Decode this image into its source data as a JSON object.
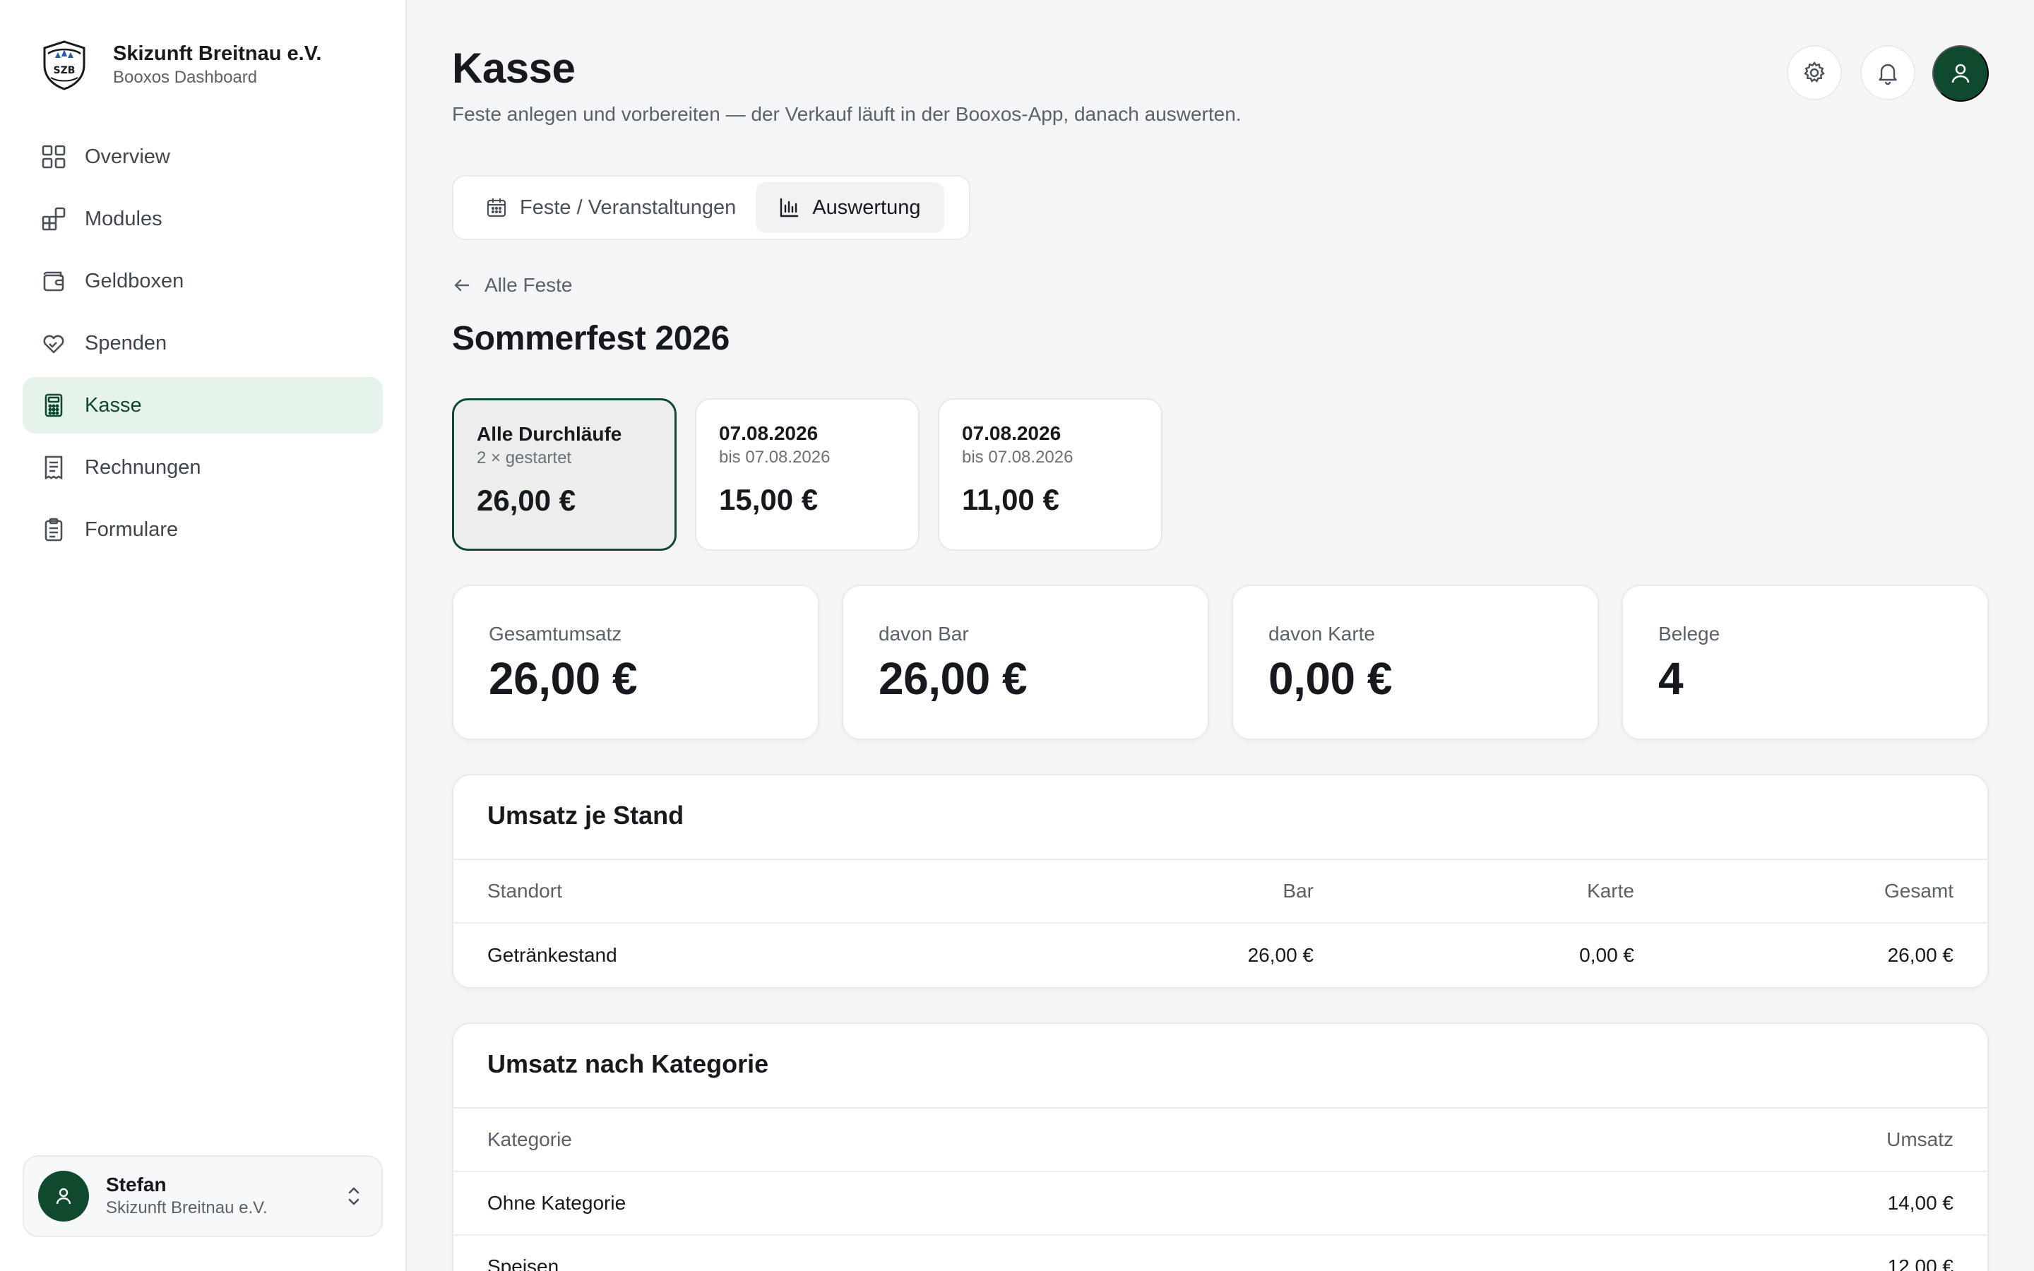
{
  "brand": {
    "name": "Skizunft Breitnau e.V.",
    "subtitle": "Booxos Dashboard",
    "logo_text": "SZB"
  },
  "nav": [
    {
      "label": "Overview",
      "icon": "grid-icon",
      "active": false
    },
    {
      "label": "Modules",
      "icon": "modules-icon",
      "active": false
    },
    {
      "label": "Geldboxen",
      "icon": "wallet-icon",
      "active": false
    },
    {
      "label": "Spenden",
      "icon": "heart-hand-icon",
      "active": false
    },
    {
      "label": "Kasse",
      "icon": "calculator-icon",
      "active": true
    },
    {
      "label": "Rechnungen",
      "icon": "receipt-icon",
      "active": false
    },
    {
      "label": "Formulare",
      "icon": "clipboard-icon",
      "active": false
    }
  ],
  "user": {
    "name": "Stefan",
    "org": "Skizunft Breitnau e.V."
  },
  "header": {
    "title": "Kasse",
    "subtitle": "Feste anlegen und vorbereiten — der Verkauf läuft in der Booxos-App, danach auswerten."
  },
  "tabs": [
    {
      "label": "Feste / Veranstaltungen",
      "icon": "calendar-icon",
      "active": false
    },
    {
      "label": "Auswertung",
      "icon": "bar-chart-icon",
      "active": true
    }
  ],
  "back_link": "Alle Feste",
  "event_title": "Sommerfest 2026",
  "runs": [
    {
      "label": "Alle Durchläufe",
      "sub": "2 × gestartet",
      "amount": "26,00 €",
      "active": true
    },
    {
      "label": "07.08.2026",
      "sub": "bis 07.08.2026",
      "amount": "15,00 €",
      "active": false
    },
    {
      "label": "07.08.2026",
      "sub": "bis 07.08.2026",
      "amount": "11,00 €",
      "active": false
    }
  ],
  "stats": [
    {
      "label": "Gesamtumsatz",
      "value": "26,00 €"
    },
    {
      "label": "davon Bar",
      "value": "26,00 €"
    },
    {
      "label": "davon Karte",
      "value": "0,00 €"
    },
    {
      "label": "Belege",
      "value": "4"
    }
  ],
  "stand_table": {
    "title": "Umsatz je Stand",
    "headers": {
      "standort": "Standort",
      "bar": "Bar",
      "karte": "Karte",
      "gesamt": "Gesamt"
    },
    "rows": [
      {
        "standort": "Getränkestand",
        "bar": "26,00 €",
        "karte": "0,00 €",
        "gesamt": "26,00 €"
      }
    ]
  },
  "kategorie_table": {
    "title": "Umsatz nach Kategorie",
    "headers": {
      "kategorie": "Kategorie",
      "umsatz": "Umsatz"
    },
    "rows": [
      {
        "kategorie": "Ohne Kategorie",
        "umsatz": "14,00 €"
      },
      {
        "kategorie": "Speisen",
        "umsatz": "12,00 €"
      }
    ]
  },
  "colors": {
    "accent": "#0f4a2f",
    "active_nav_bg": "#e5f3ea",
    "page_bg": "#f4f5f7"
  }
}
